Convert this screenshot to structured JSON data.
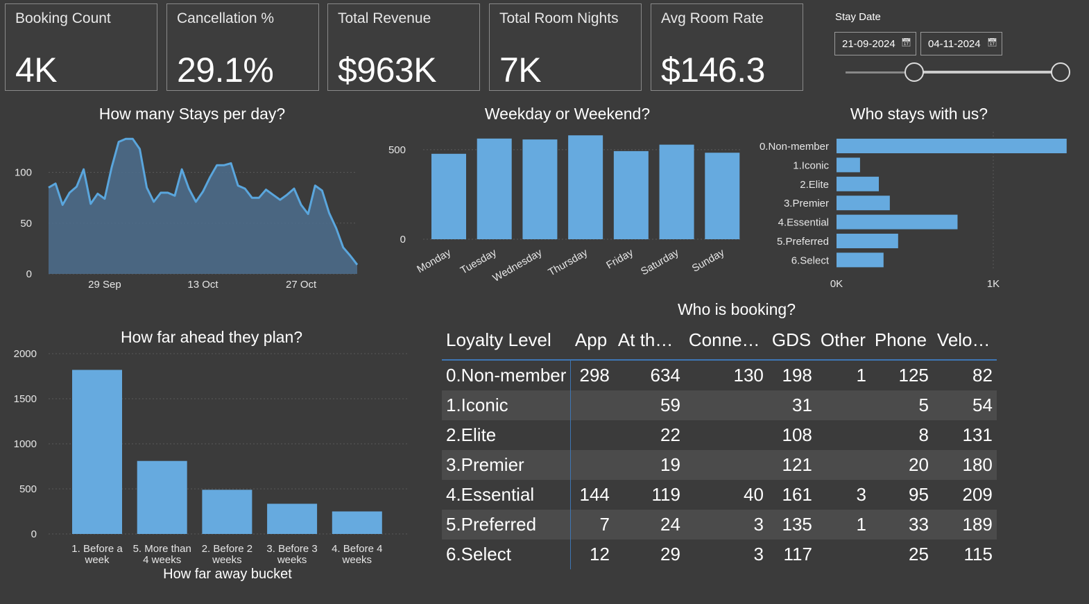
{
  "kpis": [
    {
      "label": "Booking Count",
      "value": "4K"
    },
    {
      "label": "Cancellation %",
      "value": "29.1%"
    },
    {
      "label": "Total Revenue",
      "value": "$963K"
    },
    {
      "label": "Total Room Nights",
      "value": "7K"
    },
    {
      "label": "Avg Room Rate",
      "value": "$146.3"
    }
  ],
  "slicer": {
    "title": "Stay Date",
    "start": "21-09-2024",
    "end": "04-11-2024",
    "start_fraction": 0.33,
    "end_fraction": 1.0
  },
  "chart_data": [
    {
      "type": "area",
      "title": "How many Stays per day?",
      "xlabel": "",
      "ylabel": "",
      "x_tick_labels": [
        "29 Sep",
        "13 Oct",
        "27 Oct"
      ],
      "x_tick_index": [
        8,
        22,
        36
      ],
      "y_ticks": [
        0,
        50,
        100
      ],
      "ylim": [
        0,
        140
      ],
      "values": [
        85,
        89,
        68,
        80,
        86,
        103,
        69,
        79,
        74,
        105,
        130,
        133,
        133,
        123,
        85,
        71,
        80,
        80,
        77,
        103,
        84,
        71,
        81,
        95,
        107,
        107,
        109,
        87,
        84,
        75,
        75,
        83,
        78,
        73,
        78,
        84,
        68,
        59,
        87,
        82,
        60,
        45,
        26,
        18,
        9
      ],
      "color": "#5aa6dd"
    },
    {
      "type": "bar",
      "title": "Weekday or Weekend?",
      "xlabel": "",
      "ylabel": "",
      "categories": [
        "Monday",
        "Tuesday",
        "Wednesday",
        "Thursday",
        "Friday",
        "Saturday",
        "Sunday"
      ],
      "values": [
        477,
        562,
        557,
        580,
        492,
        528,
        483
      ],
      "y_ticks": [
        0,
        500
      ],
      "ylim": [
        0,
        600
      ],
      "color": "#66aadf"
    },
    {
      "type": "bar",
      "orientation": "horizontal",
      "title": "Who stays with us?",
      "xlabel": "",
      "ylabel": "",
      "categories": [
        "0.Non-member",
        "1.Iconic",
        "2.Elite",
        "3.Premier",
        "4.Essential",
        "5.Preferred",
        "6.Select"
      ],
      "values": [
        1468,
        150,
        270,
        340,
        772,
        393,
        300
      ],
      "x_ticks": [
        0,
        1000
      ],
      "x_tick_labels": [
        "0K",
        "1K"
      ],
      "xlim": [
        0,
        1000
      ],
      "color": "#66aadf"
    },
    {
      "type": "bar",
      "title": "How far ahead they plan?",
      "xlabel": "How far away bucket",
      "ylabel": "",
      "categories": [
        "1. Before a week",
        "5. More than 4 weeks",
        "2. Before 2 weeks",
        "3. Before 3 weeks",
        "4. Before 4 weeks"
      ],
      "category_lines": [
        [
          "1. Before a",
          "week"
        ],
        [
          "5. More than",
          "4 weeks"
        ],
        [
          "2. Before 2",
          "weeks"
        ],
        [
          "3. Before 3",
          "weeks"
        ],
        [
          "4. Before 4",
          "weeks"
        ]
      ],
      "values": [
        1820,
        810,
        490,
        335,
        250
      ],
      "y_ticks": [
        0,
        500,
        1000,
        1500,
        2000
      ],
      "ylim": [
        0,
        2000
      ],
      "color": "#66aadf"
    },
    {
      "type": "table",
      "title": "Who is booking?",
      "columns": [
        "Loyalty Level",
        "App",
        "At th…",
        "Conne…",
        "GDS",
        "Other",
        "Phone",
        "Velo…"
      ],
      "rows": [
        [
          "0.Non-member",
          "298",
          "634",
          "130",
          "198",
          "1",
          "125",
          "82"
        ],
        [
          "1.Iconic",
          "",
          "59",
          "",
          "31",
          "",
          "5",
          "54"
        ],
        [
          "2.Elite",
          "",
          "22",
          "",
          "108",
          "",
          "8",
          "131"
        ],
        [
          "3.Premier",
          "",
          "19",
          "",
          "121",
          "",
          "20",
          "180"
        ],
        [
          "4.Essential",
          "144",
          "119",
          "40",
          "161",
          "3",
          "95",
          "209"
        ],
        [
          "5.Preferred",
          "7",
          "24",
          "3",
          "135",
          "1",
          "33",
          "189"
        ],
        [
          "6.Select",
          "12",
          "29",
          "3",
          "117",
          "",
          "25",
          "115"
        ]
      ]
    }
  ]
}
